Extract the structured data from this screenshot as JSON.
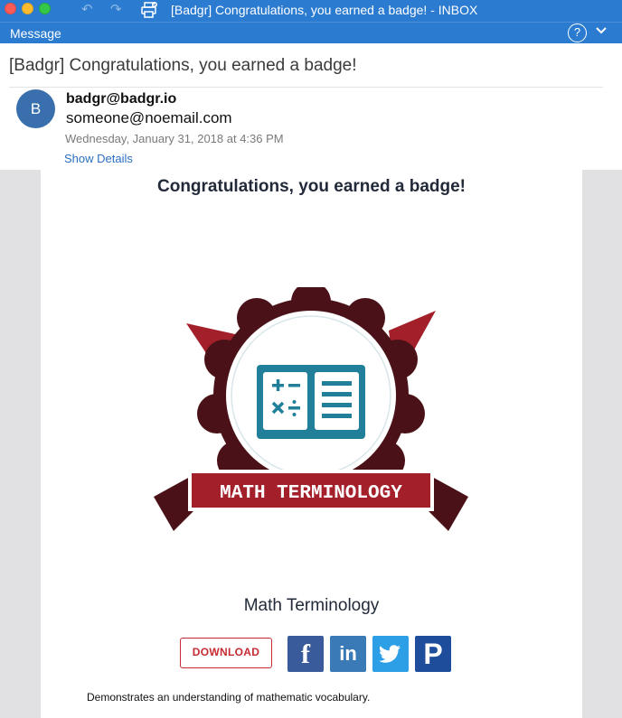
{
  "window": {
    "title": "[Badgr] Congratulations, you earned a badge! - INBOX"
  },
  "toolbar": {
    "icons": [
      "undo-icon",
      "redo-icon",
      "printer-icon"
    ]
  },
  "ribbon": {
    "tab_label": "Message",
    "help_label": "?",
    "chevron": "⌄"
  },
  "message": {
    "subject": "[Badgr] Congratulations, you earned a badge!",
    "avatar_initial": "B",
    "from": "badgr@badgr.io",
    "to": "someone@noemail.com",
    "date": "Wednesday, January 31, 2018 at 4:36 PM",
    "show_details": "Show Details"
  },
  "email_body": {
    "heading": "Congratulations, you earned a badge!",
    "badge_banner_text": "MATH TERMINOLOGY",
    "badge_name": "Math Terminology",
    "download_label": "DOWNLOAD",
    "social": {
      "facebook": "f",
      "linkedin": "in",
      "pinterest": "P"
    },
    "description": "Demonstrates an understanding of mathematic vocabulary."
  },
  "colors": {
    "accent_blue": "#2b7bd1",
    "badge_dark": "#4a1218",
    "badge_red": "#a3202b",
    "badge_teal": "#217f9a",
    "download_red": "#c62b34"
  }
}
